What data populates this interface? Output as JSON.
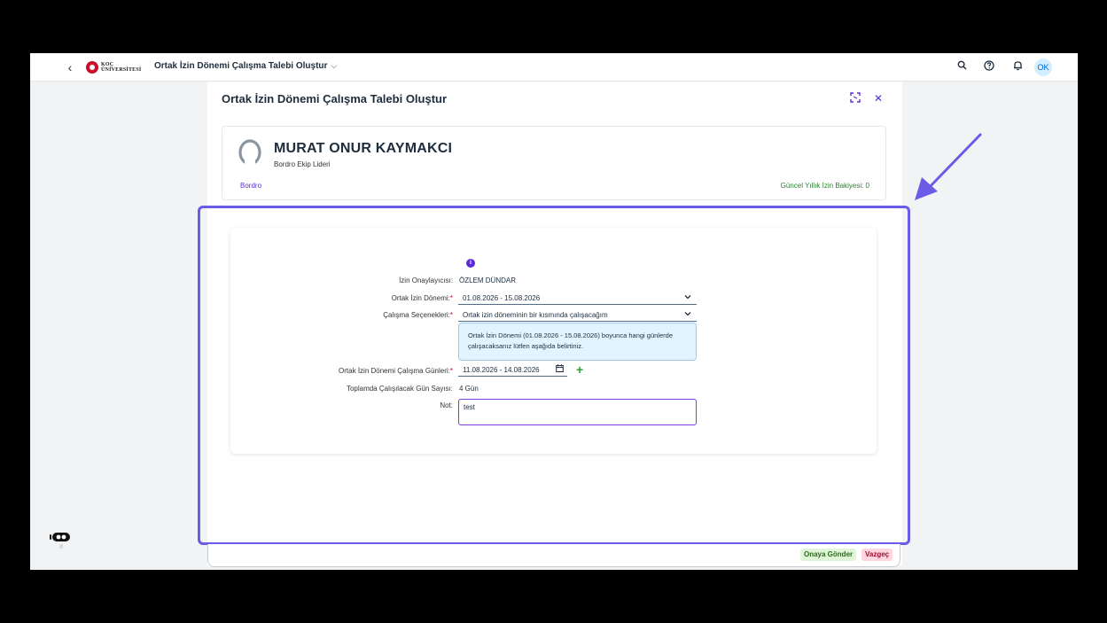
{
  "shell": {
    "back_glyph": "‹",
    "logo_line1": "KOÇ",
    "logo_line2": "ÜNİVERSİTESİ",
    "title": "Ortak İzin Dönemi Çalışma Talebi Oluştur",
    "title_chevron": "⌵",
    "avatar_initials": "OK",
    "icons": [
      "search-icon",
      "help-icon",
      "bell-icon"
    ]
  },
  "dialog": {
    "title": "Ortak İzin Dönemi Çalışma Talebi Oluştur",
    "fullscreen_glyph": "⛶",
    "close_glyph": "✕"
  },
  "employee": {
    "name": "MURAT ONUR KAYMAKCI",
    "role": "Bordro Ekip Lideri",
    "department": "Bordro",
    "balance": "Güncel Yıllık İzin Bakiyesi: 0"
  },
  "form": {
    "info_glyph": "i",
    "approver_label": "İzin Onaylayıcısı:",
    "approver_value": "ÖZLEM DÜNDAR",
    "period_label": "Ortak İzin Dönemi:",
    "period_value": "01.08.2026 - 15.08.2026",
    "work_option_label": "Çalışma Seçenekleri:",
    "work_option_value": "Ortak izin döneminin bir kısmında çalışacağım",
    "info_message": "Ortak İzin Dönemi (01.08.2026 - 15.08.2026) boyunca hangi günlerde çalışacaksanız lütfen aşağıda belirtiniz.",
    "work_days_label": "Ortak İzin Dönemi Çalışma Günleri:",
    "work_days_value": "11.08.2026 - 14.08.2026",
    "total_days_label": "Toplamda Çalışılacak Gün Sayısı:",
    "total_days_value": "4 Gün",
    "note_label": "Not:",
    "note_value": "test",
    "required_mark": "*",
    "select_chevron": "⌄",
    "calendar_glyph": "▦",
    "add_glyph": "+"
  },
  "footer": {
    "submit_label": "Onaya Gönder",
    "cancel_label": "Vazgeç"
  },
  "colors": {
    "accent": "#5b2bd9",
    "highlight": "#6b5ce8",
    "success": "#2e7d32",
    "required": "#d0021b"
  }
}
